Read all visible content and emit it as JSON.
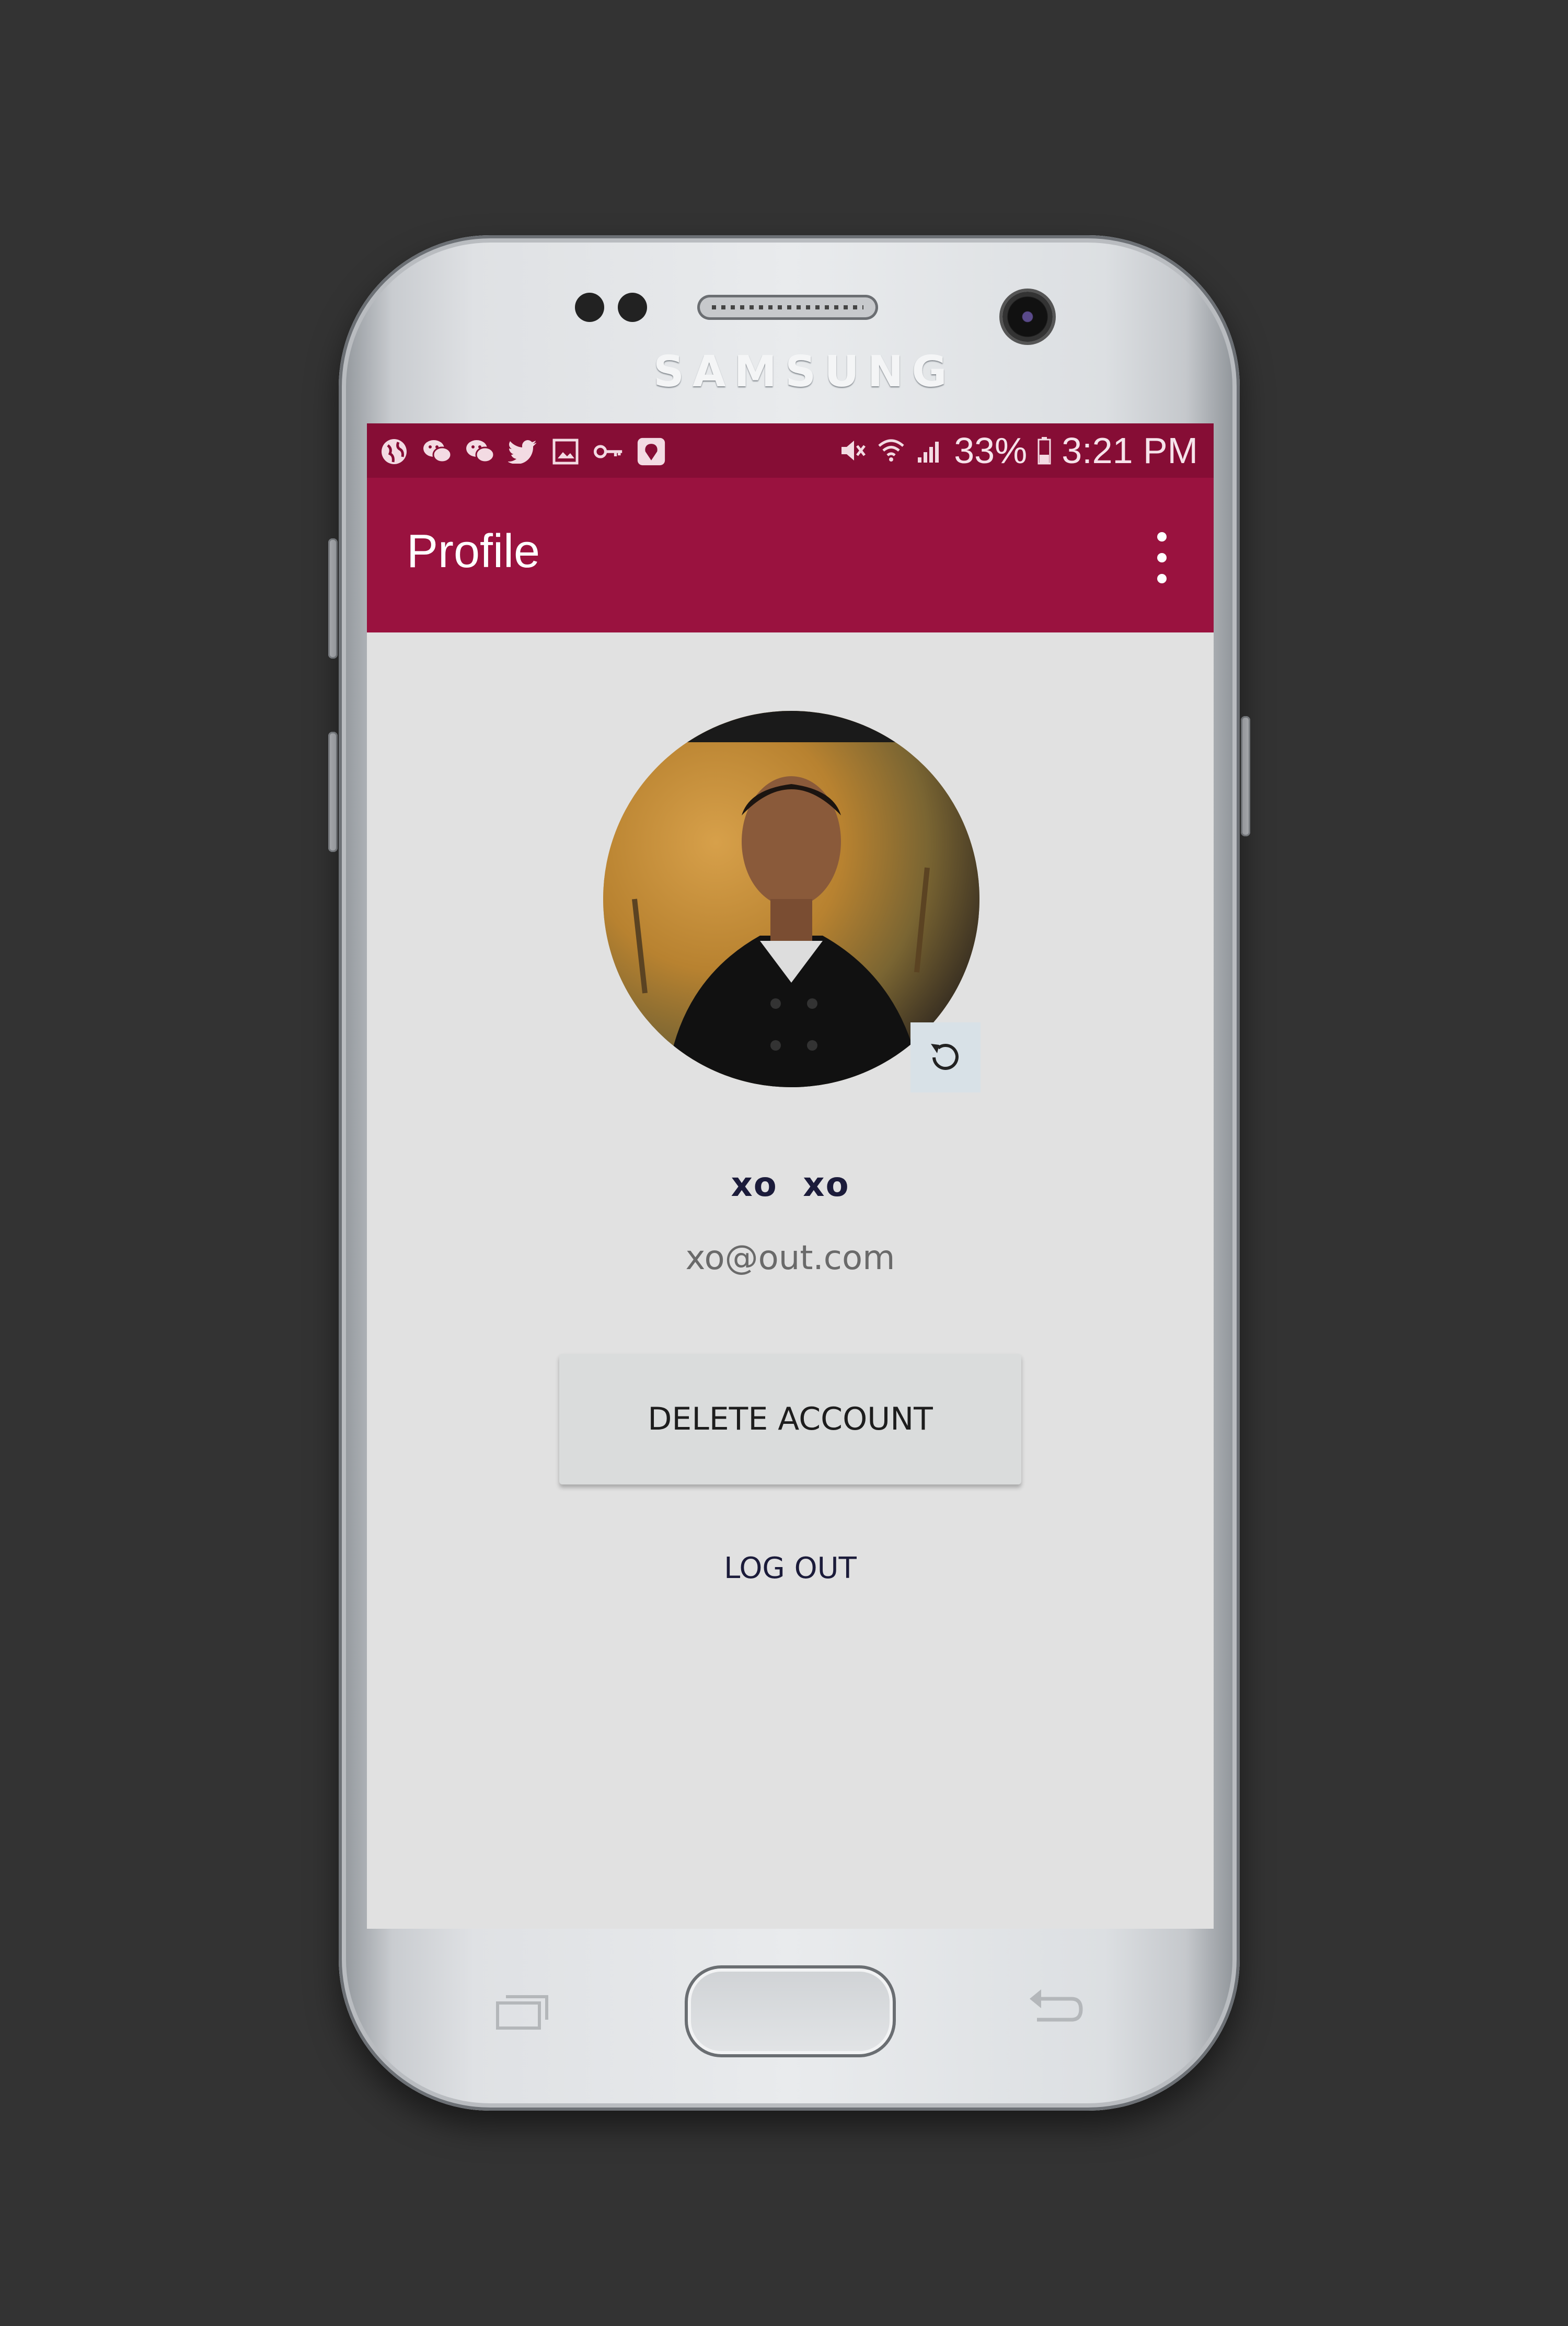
{
  "device": {
    "brand": "SAMSUNG"
  },
  "status_bar": {
    "battery": "33%",
    "time": "3:21 PM",
    "left_icons": [
      "globe-icon",
      "wechat-icon",
      "wechat-icon",
      "twitter-icon",
      "image-icon",
      "key-icon",
      "du-icon"
    ],
    "right_icons": [
      "mute-icon",
      "wifi-icon",
      "signal-icon",
      "battery-icon"
    ],
    "color": "#860d35"
  },
  "app_bar": {
    "title": "Profile",
    "color": "#9a123f"
  },
  "profile": {
    "name": "xo  xo",
    "email": "xo@out.com"
  },
  "actions": {
    "delete_label": "DELETE ACCOUNT",
    "logout_label": "LOG OUT"
  }
}
